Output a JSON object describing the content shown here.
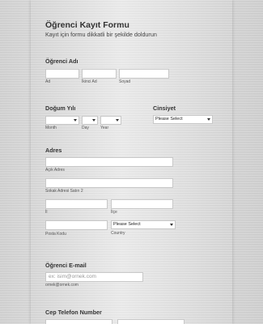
{
  "form": {
    "title": "Öğrenci Kayıt Formu",
    "subtitle": "Kayıt için formu dikkatli bir şekilde doldurun"
  },
  "student_name": {
    "label": "Öğrenci Adı",
    "first_sub": "Ad",
    "middle_sub": "İkinci Ad",
    "last_sub": "Soyad"
  },
  "birth_date": {
    "label": "Doğum Yılı",
    "month_sub": "Month",
    "day_sub": "Day",
    "year_sub": "Year"
  },
  "gender": {
    "label": "Cinsiyet",
    "selected": "Please Select"
  },
  "address": {
    "label": "Adres",
    "line1_sub": "Açık Adres",
    "line2_sub": "Sokak Adresi Satırı 2",
    "city_sub": "İl",
    "district_sub": "İlçe",
    "postal_sub": "Posta Kodu",
    "country_sub": "Country",
    "country_selected": "Please Select"
  },
  "email": {
    "label": "Öğrenci E-mail",
    "placeholder": "ex: isim@ornek.com",
    "sub": "ornek@ornek.com"
  },
  "phone": {
    "label": "Cep Telefon Number"
  }
}
